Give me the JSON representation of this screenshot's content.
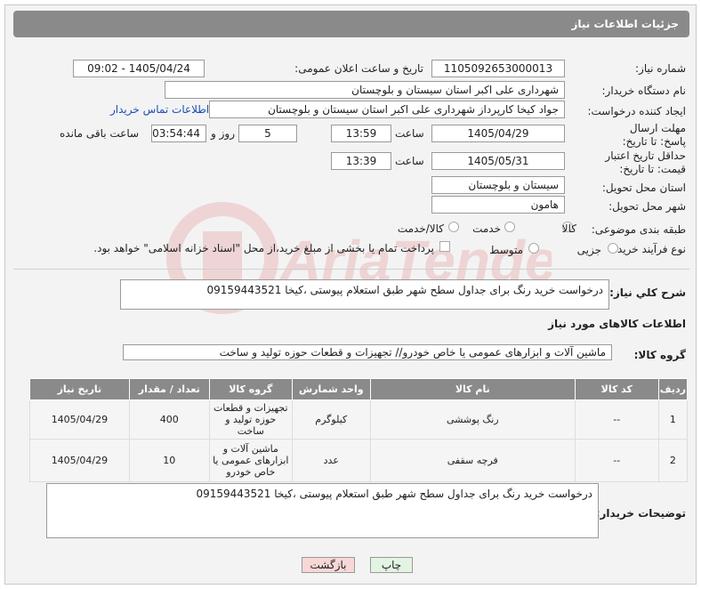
{
  "header": {
    "title": "جزئیات اطلاعات نیاز"
  },
  "fields": {
    "need_number_label": "شماره نیاز:",
    "need_number": "1105092653000013",
    "announce_label": "تاریخ و ساعت اعلان عمومی:",
    "announce_value": "1405/04/24 - 09:02",
    "buyer_org_label": "نام دستگاه خریدار:",
    "buyer_org": "شهرداری علی اکبر استان سیستان و بلوچستان",
    "creator_label": "ایجاد کننده درخواست:",
    "creator": "جواد کیخا کارپرداز شهرداری علی اکبر استان سیستان و بلوچستان",
    "contact_link": "اطلاعات تماس خریدار",
    "reply_deadline_label": "مهلت ارسال پاسخ: تا تاریخ:",
    "reply_date": "1405/04/29",
    "time_label": "ساعت",
    "reply_time": "13:59",
    "days_value": "5",
    "days_label": "روز و",
    "remaining_time": "03:54:44",
    "remaining_label": "ساعت باقی مانده",
    "validity_label": "حداقل تاریخ اعتبار قیمت: تا تاریخ:",
    "validity_date": "1405/05/31",
    "validity_time": "13:39",
    "province_label": "استان محل تحویل:",
    "province": "سیستان و بلوچستان",
    "city_label": "شهر محل تحویل:",
    "city": "هامون",
    "category_label": "طبقه بندی موضوعی:",
    "category_options": [
      "کالا",
      "خدمت",
      "کالا/خدمت"
    ],
    "process_label": "نوع فرآیند خرید :",
    "process_options": [
      "جزیی",
      "متوسط"
    ],
    "payment_note": "پرداخت تمام یا بخشی از مبلغ خرید،از محل \"اسناد خزانه اسلامی\" خواهد بود."
  },
  "description": {
    "label": "شرح کلي نياز:",
    "value": "درخواست خرید رنگ برای جداول سطح شهر طبق استعلام پیوستی ،کیخا 09159443521"
  },
  "goods_section": {
    "title": "اطلاعات کالاهای مورد نیاز",
    "group_label": "گروه کالا:",
    "group_value": "ماشین آلات و ابزارهای عمومی یا خاص خودرو// تجهیزات و قطعات حوزه تولید و ساخت"
  },
  "table": {
    "headers": [
      "ردیف",
      "کد کالا",
      "نام کالا",
      "واحد شمارش",
      "گروه کالا",
      "تعداد / مقدار",
      "تاریخ نیاز"
    ],
    "rows": [
      [
        "1",
        "--",
        "رنگ پوششی",
        "کیلوگرم",
        "تجهیزات و قطعات حوزه تولید و ساخت",
        "400",
        "1405/04/29"
      ],
      [
        "2",
        "--",
        "فرچه سقفی",
        "عدد",
        "ماشین آلات و ابزارهای عمومی یا خاص خودرو",
        "10",
        "1405/04/29"
      ]
    ]
  },
  "buyer_notes": {
    "label": "توضیحات خریدار:",
    "value": "درخواست خرید رنگ برای جداول سطح شهر طبق استعلام پیوستی ،کیخا 09159443521"
  },
  "buttons": {
    "print": "چاپ",
    "back": "بازگشت"
  },
  "colors": {
    "header_bg": "#8a8a8a",
    "link": "#1a4fb8",
    "back_btn": "#f8d7d7",
    "print_btn": "#e4f4e4"
  },
  "watermark_text": "AriaTender.neT"
}
